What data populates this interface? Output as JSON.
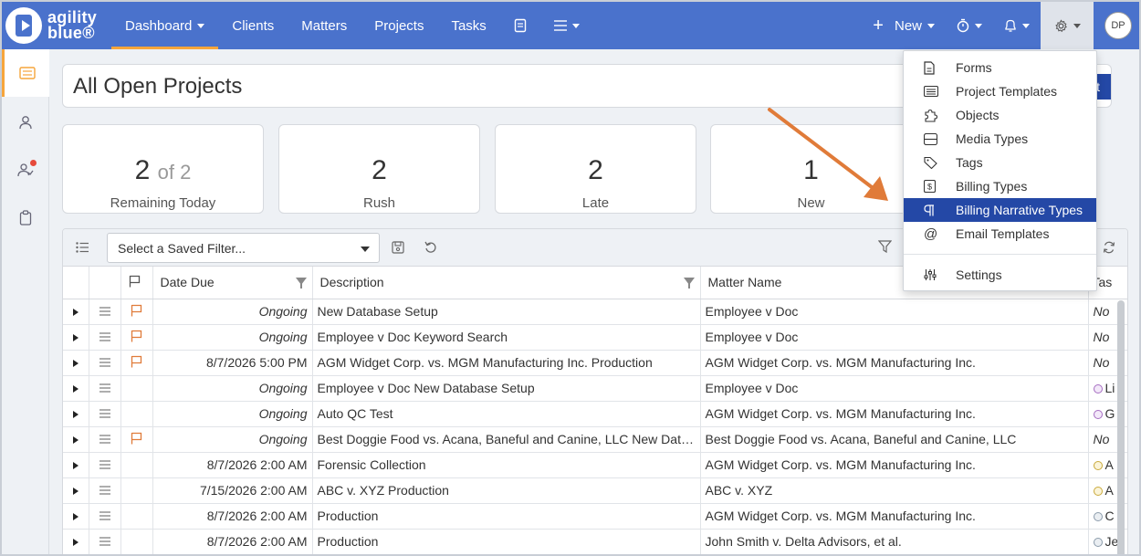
{
  "app": {
    "logo_line1": "agility",
    "logo_line2": "blue®"
  },
  "nav": {
    "items": [
      {
        "label": "Dashboard",
        "dropdown": true,
        "active": true
      },
      {
        "label": "Clients"
      },
      {
        "label": "Matters"
      },
      {
        "label": "Projects"
      },
      {
        "label": "Tasks"
      }
    ],
    "new_label": "New",
    "avatar_initials": "DP"
  },
  "page": {
    "title": "All Open Projects",
    "title_button_label": "t"
  },
  "stats": [
    {
      "value": "2",
      "of": "of 2",
      "label": "Remaining Today"
    },
    {
      "value": "2",
      "label": "Rush"
    },
    {
      "value": "2",
      "label": "Late"
    },
    {
      "value": "1",
      "label": "New"
    }
  ],
  "toolbar": {
    "filter_placeholder": "Select a Saved Filter..."
  },
  "grid": {
    "columns": [
      "Date Due",
      "Description",
      "Matter Name",
      "Tas"
    ],
    "rows": [
      {
        "flag": true,
        "date": "Ongoing",
        "ongoing": true,
        "description": "New Database Setup",
        "matter": "Employee v Doc",
        "tas": "No",
        "dot": ""
      },
      {
        "flag": true,
        "date": "Ongoing",
        "ongoing": true,
        "description": "Employee v Doc Keyword Search",
        "matter": "Employee v Doc",
        "tas": "No",
        "dot": ""
      },
      {
        "flag": true,
        "date": "8/7/2026 5:00 PM",
        "ongoing": false,
        "description": "AGM Widget Corp. vs. MGM Manufacturing Inc. Production",
        "matter": "AGM Widget Corp. vs. MGM Manufacturing Inc.",
        "tas": "No",
        "dot": ""
      },
      {
        "flag": false,
        "date": "Ongoing",
        "ongoing": true,
        "description": "Employee v Doc New Database Setup",
        "matter": "Employee v Doc",
        "tas": "Li",
        "dot": "purple"
      },
      {
        "flag": false,
        "date": "Ongoing",
        "ongoing": true,
        "description": "Auto QC Test",
        "matter": "AGM Widget Corp. vs. MGM Manufacturing Inc.",
        "tas": "G",
        "dot": "purple"
      },
      {
        "flag": true,
        "date": "Ongoing",
        "ongoing": true,
        "description": "Best Doggie Food vs. Acana, Baneful and Canine, LLC New Datab...",
        "matter": "Best Doggie Food vs. Acana, Baneful and Canine, LLC",
        "tas": "No",
        "dot": ""
      },
      {
        "flag": false,
        "date": "8/7/2026 2:00 AM",
        "ongoing": false,
        "description": "Forensic Collection",
        "matter": "AGM Widget Corp. vs. MGM Manufacturing Inc.",
        "tas": "A",
        "dot": "yellow"
      },
      {
        "flag": false,
        "date": "7/15/2026 2:00 AM",
        "ongoing": false,
        "late": true,
        "description": "ABC v. XYZ Production",
        "matter": "ABC v. XYZ",
        "tas": "A",
        "dot": "yellow"
      },
      {
        "flag": false,
        "date": "8/7/2026 2:00 AM",
        "ongoing": false,
        "description": "Production",
        "matter": "AGM Widget Corp. vs. MGM Manufacturing Inc.",
        "tas": "C",
        "dot": "gray"
      },
      {
        "flag": false,
        "date": "8/7/2026 2:00 AM",
        "ongoing": false,
        "description": "Production",
        "matter": "John Smith v. Delta Advisors, et al.",
        "tas": "Je",
        "dot": "gray"
      }
    ]
  },
  "settings_menu": {
    "items": [
      {
        "label": "Forms",
        "icon": "form-icon"
      },
      {
        "label": "Project Templates",
        "icon": "list-icon"
      },
      {
        "label": "Objects",
        "icon": "puzzle-icon"
      },
      {
        "label": "Media Types",
        "icon": "media-icon"
      },
      {
        "label": "Tags",
        "icon": "tag-icon"
      },
      {
        "label": "Billing Types",
        "icon": "dollar-icon"
      },
      {
        "label": "Billing Narrative Types",
        "icon": "paragraph-icon",
        "active": true
      },
      {
        "label": "Email Templates",
        "icon": "at-icon"
      }
    ],
    "footer_item": {
      "label": "Settings",
      "icon": "sliders-icon"
    }
  },
  "colors": {
    "nav_bg": "#4a72cc",
    "accent": "#f6a53b",
    "selected": "#2448a6",
    "late": "#b03a2e",
    "arrow": "#e07b39"
  }
}
